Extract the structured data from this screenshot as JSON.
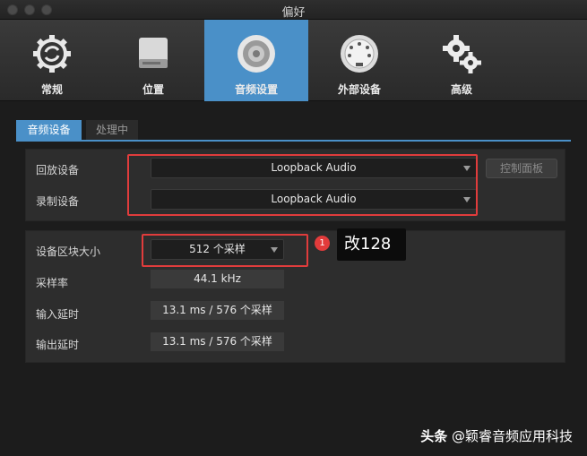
{
  "window": {
    "title": "偏好"
  },
  "toolbar": {
    "items": [
      {
        "label": "常规",
        "icon": "gear-sync-icon",
        "active": false
      },
      {
        "label": "位置",
        "icon": "drive-icon",
        "active": false
      },
      {
        "label": "音频设置",
        "icon": "speaker-icon",
        "active": true
      },
      {
        "label": "外部设备",
        "icon": "midi-connector-icon",
        "active": false
      },
      {
        "label": "高级",
        "icon": "gears-icon",
        "active": false
      }
    ]
  },
  "tabs": {
    "active": "音频设备",
    "inactive": "处理中"
  },
  "devices": {
    "playback_label": "回放设备",
    "playback_value": "Loopback Audio",
    "record_label": "录制设备",
    "record_value": "Loopback Audio",
    "control_panel_label": "控制面板"
  },
  "settings": {
    "block_size_label": "设备区块大小",
    "block_size_value": "512 个采样",
    "sample_rate_label": "采样率",
    "sample_rate_value": "44.1 kHz",
    "input_latency_label": "输入延时",
    "input_latency_value": "13.1 ms / 576 个采样",
    "output_latency_label": "输出延时",
    "output_latency_value": "13.1 ms / 576 个采样"
  },
  "annotation": {
    "badge": "1",
    "note": "改128"
  },
  "watermark": {
    "prefix": "头条",
    "text": " @颖睿音频应用科技"
  },
  "colors": {
    "accent": "#4a90c8",
    "highlight": "#e03c3c"
  }
}
